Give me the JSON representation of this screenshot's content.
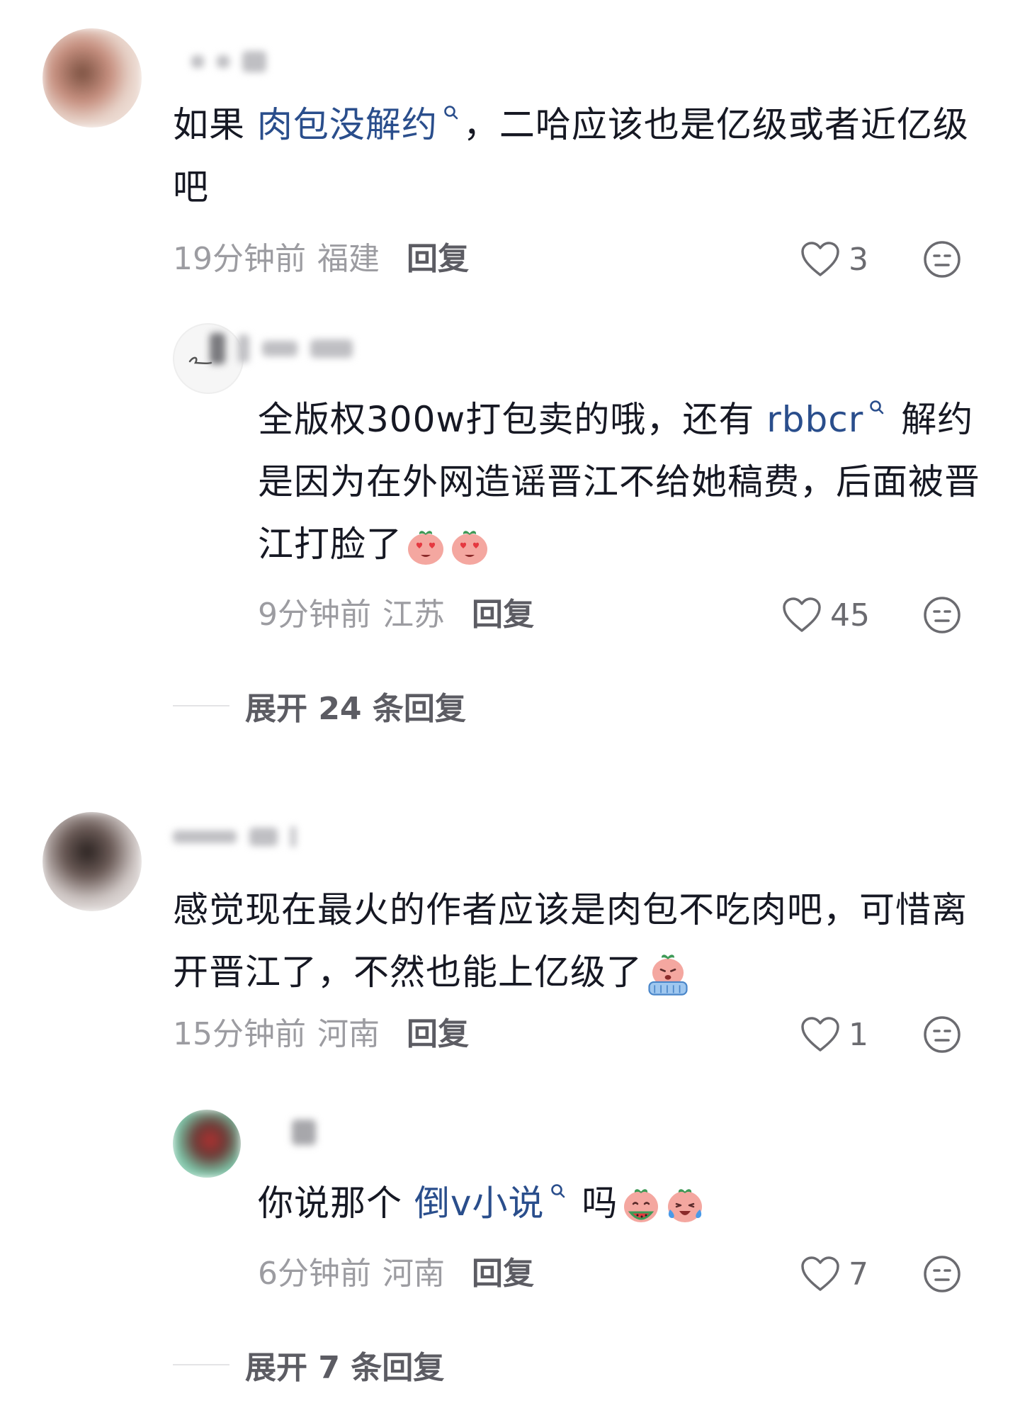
{
  "comments": [
    {
      "text_before": "如果 ",
      "link": "肉包没解约",
      "text_after": "，二哈应该也是亿级或者近亿级吧",
      "time": "19分钟前",
      "location": "福建",
      "reply_label": "回复",
      "likes": "3",
      "replies": [
        {
          "text_before": "全版权300w打包卖的哦，还有 ",
          "link": "rbbcr",
          "text_after": " 解约是因为在外网造谣晋江不给她稿费，后面被晋江打脸了",
          "emojis": [
            "heart-eyes-emoji",
            "heart-eyes-emoji"
          ],
          "time": "9分钟前",
          "location": "江苏",
          "reply_label": "回复",
          "likes": "45"
        }
      ],
      "expand_label": "展开 24 条回复"
    },
    {
      "text": "感觉现在最火的作者应该是肉包不吃肉吧，可惜离开晋江了，不然也能上亿级了",
      "emojis": [
        "crying-emoji"
      ],
      "time": "15分钟前",
      "location": "河南",
      "reply_label": "回复",
      "likes": "1",
      "replies": [
        {
          "text_before": "你说那个 ",
          "link": "倒v小说",
          "text_after": " 吗",
          "emojis": [
            "eating-watermelon-emoji",
            "laughing-tears-emoji"
          ],
          "time": "6分钟前",
          "location": "河南",
          "reply_label": "回复",
          "likes": "7"
        }
      ],
      "expand_label": "展开 7 条回复"
    }
  ],
  "colors": {
    "link": "#2a4e8c",
    "meta": "#9c9ca1",
    "text": "#161823"
  }
}
